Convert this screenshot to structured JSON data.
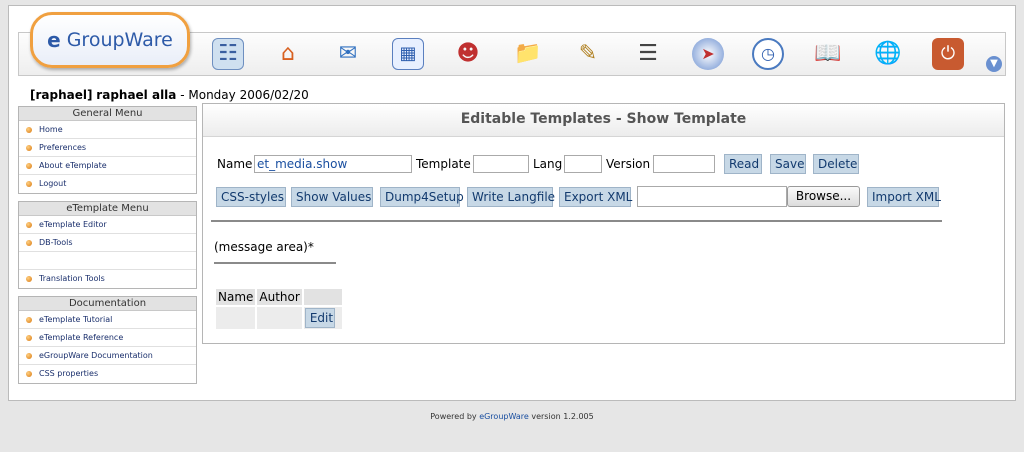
{
  "app": {
    "logo_mark": "e",
    "logo_text": "GroupWare"
  },
  "toolbar_icons": [
    "user-groups-icon",
    "home-icon",
    "email-icon",
    "calendar-icon",
    "addressbook-icon",
    "files-icon",
    "infolog-icon",
    "projects-icon",
    "sitemgr-icon",
    "timesheet-icon",
    "manual-icon",
    "wiki-icon",
    "logout-icon",
    "scroll-down-icon"
  ],
  "user": {
    "login": "[raphael]",
    "name": "raphael alla",
    "date_sep": " - ",
    "date": "Monday 2006/02/20"
  },
  "menus": {
    "general": {
      "title": "General Menu",
      "items": [
        "Home",
        "Preferences",
        "About eTemplate",
        "Logout"
      ]
    },
    "etemplate": {
      "title": "eTemplate Menu",
      "items": [
        "eTemplate Editor",
        "DB-Tools",
        "Translation Tools"
      ]
    },
    "docs": {
      "title": "Documentation",
      "items": [
        "eTemplate Tutorial",
        "eTemplate Reference",
        "eGroupWare Documentation",
        "CSS properties"
      ]
    }
  },
  "main": {
    "title": "Editable Templates - Show Template",
    "form": {
      "name_label": "Name",
      "name_value": "et_media.show",
      "template_label": "Template",
      "template_value": "",
      "lang_label": "Lang",
      "lang_value": "",
      "version_label": "Version",
      "version_value": "",
      "read": "Read",
      "save": "Save",
      "delete": "Delete"
    },
    "actions": {
      "css_styles": "CSS-styles",
      "show_values": "Show Values",
      "dump4setup": "Dump4Setup",
      "write_langfile": "Write Langfile",
      "export_xml": "Export XML",
      "file_value": "",
      "browse": "Browse...",
      "import_xml": "Import XML"
    },
    "message_area": "(message area)*",
    "table": {
      "headers": [
        "Name",
        "Author",
        ""
      ],
      "edit_label": "Edit"
    }
  },
  "footer": {
    "prefix": "Powered by ",
    "link": "eGroupWare",
    "suffix": " version 1.2.005"
  },
  "colors": {
    "button_bg": "#c7d8e6",
    "logo_border": "#f0a040",
    "link": "#1a4fa0"
  }
}
